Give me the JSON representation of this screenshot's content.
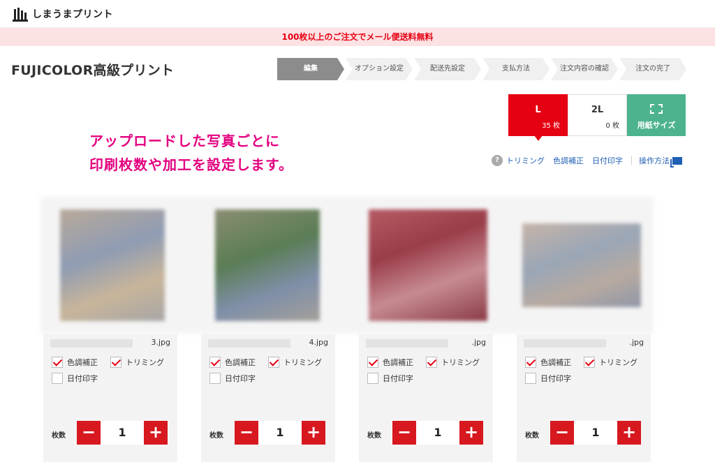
{
  "header": {
    "logo_text": "しまうまプリント"
  },
  "promo": {
    "text": "100枚以上のご注文でメール便送料無料"
  },
  "page": {
    "title": "FUJICOLOR高級プリント"
  },
  "steps": [
    {
      "label": "編集",
      "active": true
    },
    {
      "label": "オプション設定"
    },
    {
      "label": "配送先設定"
    },
    {
      "label": "支払方法"
    },
    {
      "label": "注文内容の確認"
    },
    {
      "label": "注文の完了"
    }
  ],
  "size_tabs": [
    {
      "name": "L",
      "count": "35 枚",
      "active": true
    },
    {
      "name": "2L",
      "count": "0 枚"
    }
  ],
  "paper_button": {
    "label": "用紙サイズ"
  },
  "hero": {
    "line1": "アップロードした写真ごとに",
    "line2": "印刷枚数や加工を設定します。"
  },
  "links": {
    "help_icon": "?",
    "trimming": "トリミング",
    "color": "色調補正",
    "date": "日付印字",
    "guide": "操作方法"
  },
  "colors": {
    "accent_red": "#e50012",
    "promo_bg": "#fde2e4",
    "hero_pink": "#e4007f",
    "paper_green": "#4db38e",
    "link_blue": "#1f5fb4"
  },
  "cards": [
    {
      "filename": "3.jpg",
      "color_label": "色調補正",
      "trim_label": "トリミング",
      "date_label": "日付印字",
      "qty_label": "枚数",
      "qty": "1",
      "color_checked": true,
      "trim_checked": true,
      "date_checked": false
    },
    {
      "filename": "4.jpg",
      "color_label": "色調補正",
      "trim_label": "トリミング",
      "date_label": "日付印字",
      "qty_label": "枚数",
      "qty": "1",
      "color_checked": true,
      "trim_checked": true,
      "date_checked": false
    },
    {
      "filename": ".jpg",
      "color_label": "色調補正",
      "trim_label": "トリミング",
      "date_label": "日付印字",
      "qty_label": "枚数",
      "qty": "1",
      "color_checked": true,
      "trim_checked": true,
      "date_checked": false
    },
    {
      "filename": ".jpg",
      "color_label": "色調補正",
      "trim_label": "トリミング",
      "date_label": "日付印字",
      "qty_label": "枚数",
      "qty": "1",
      "color_checked": true,
      "trim_checked": true,
      "date_checked": false
    }
  ],
  "qty_buttons": {
    "minus": "−",
    "plus": "+"
  }
}
